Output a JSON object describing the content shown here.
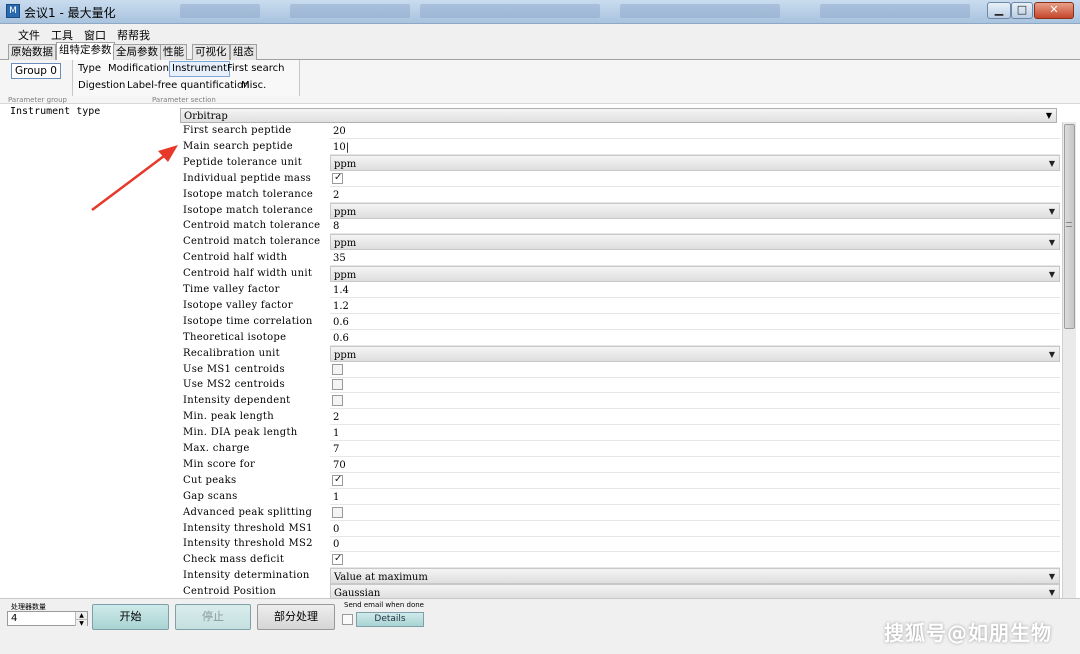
{
  "window": {
    "title": "会议1 - 最大量化",
    "buttons": {
      "minimize": "▁",
      "maximize": "□",
      "close": "✕"
    }
  },
  "menu": [
    "文件",
    "工具",
    "窗口",
    "帮帮我"
  ],
  "tabs": [
    "原始数据",
    "组特定参数",
    "全局参数",
    "性能",
    "可视化",
    "组态"
  ],
  "active_tab": "组特定参数",
  "param_group": {
    "button": "Group 0",
    "caption": "Parameter group"
  },
  "param_section": {
    "caption": "Parameter section",
    "row1": [
      "Type",
      "Modifications",
      "Instrument",
      "First search"
    ],
    "row2": [
      "Digestion",
      "Label-free quantification",
      "Misc."
    ],
    "selected": "Instrument"
  },
  "instrument_type": {
    "label": "Instrument type",
    "value": "Orbitrap"
  },
  "parameters": [
    {
      "label": "First search peptide",
      "type": "text",
      "value": "20"
    },
    {
      "label": "Main search peptide",
      "type": "text",
      "value": "10|"
    },
    {
      "label": "Peptide tolerance unit",
      "type": "combo",
      "value": "ppm"
    },
    {
      "label": "Individual peptide mass",
      "type": "check",
      "value": true
    },
    {
      "label": "Isotope match tolerance",
      "type": "text",
      "value": "2"
    },
    {
      "label": "Isotope match tolerance",
      "type": "combo",
      "value": "ppm"
    },
    {
      "label": "Centroid match tolerance",
      "type": "text",
      "value": "8"
    },
    {
      "label": "Centroid match tolerance",
      "type": "combo",
      "value": "ppm"
    },
    {
      "label": "Centroid half width",
      "type": "text",
      "value": "35"
    },
    {
      "label": "Centroid half width unit",
      "type": "combo",
      "value": "ppm"
    },
    {
      "label": "Time valley factor",
      "type": "text",
      "value": "1.4"
    },
    {
      "label": "Isotope valley factor",
      "type": "text",
      "value": "1.2"
    },
    {
      "label": "Isotope time correlation",
      "type": "text",
      "value": "0.6"
    },
    {
      "label": "Theoretical isotope",
      "type": "text",
      "value": "0.6"
    },
    {
      "label": "Recalibration unit",
      "type": "combo",
      "value": "ppm"
    },
    {
      "label": "Use MS1 centroids",
      "type": "check",
      "value": false
    },
    {
      "label": "Use MS2 centroids",
      "type": "check",
      "value": false
    },
    {
      "label": "Intensity dependent",
      "type": "check",
      "value": false
    },
    {
      "label": "Min. peak length",
      "type": "text",
      "value": "2"
    },
    {
      "label": "Min. DIA peak length",
      "type": "text",
      "value": "1"
    },
    {
      "label": "Max. charge",
      "type": "text",
      "value": "7"
    },
    {
      "label": "Min score for",
      "type": "text",
      "value": "70"
    },
    {
      "label": "Cut peaks",
      "type": "check",
      "value": true
    },
    {
      "label": "Gap scans",
      "type": "text",
      "value": "1"
    },
    {
      "label": "Advanced peak splitting",
      "type": "check",
      "value": false
    },
    {
      "label": "Intensity threshold MS1",
      "type": "text",
      "value": "0"
    },
    {
      "label": "Intensity threshold MS2",
      "type": "text",
      "value": "0"
    },
    {
      "label": "Check mass deficit",
      "type": "check",
      "value": true
    },
    {
      "label": "Intensity determination",
      "type": "combo",
      "value": "Value at maximum"
    },
    {
      "label": "Centroid Position",
      "type": "combo",
      "value": "Gaussian"
    }
  ],
  "bottom": {
    "processor_label": "处理器数量",
    "processor_count": "4",
    "start_button": "开始",
    "stop_button": "停止",
    "partial_button": "部分处理",
    "email_label": "Send email when done",
    "details_button": "Details"
  },
  "watermark": "搜狐号@如朋生物",
  "colors": {
    "annotation_arrow": "#e8382a",
    "selected_section": "#7ea6d6",
    "button_teal": "#a9d3d3"
  }
}
